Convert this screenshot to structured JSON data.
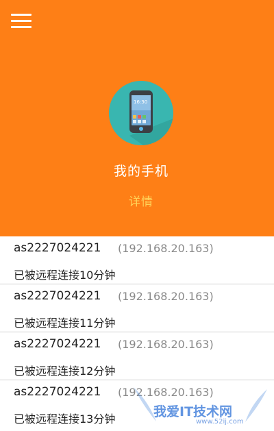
{
  "header": {
    "menu_icon": "menu-hamburger-icon",
    "device_icon": "phone-icon",
    "device_name": "我的手机",
    "details_label": "详情",
    "colors": {
      "background": "#fe7f16",
      "avatar": "#39b6b0",
      "details": "#ffd35a"
    }
  },
  "connections": [
    {
      "user": "as2227024221",
      "ip": "(192.168.20.163)",
      "status": "已被远程连接10分钟"
    },
    {
      "user": "as2227024221",
      "ip": "(192.168.20.163)",
      "status": "已被远程连接11分钟"
    },
    {
      "user": "as2227024221",
      "ip": "(192.168.20.163)",
      "status": "已被远程连接12分钟"
    },
    {
      "user": "as2227024221",
      "ip": "(192.168.20.163)",
      "status": "已被远程连接13分钟"
    }
  ],
  "watermark": {
    "text": "我爱IT技术网",
    "site": "www.52ij.com"
  }
}
